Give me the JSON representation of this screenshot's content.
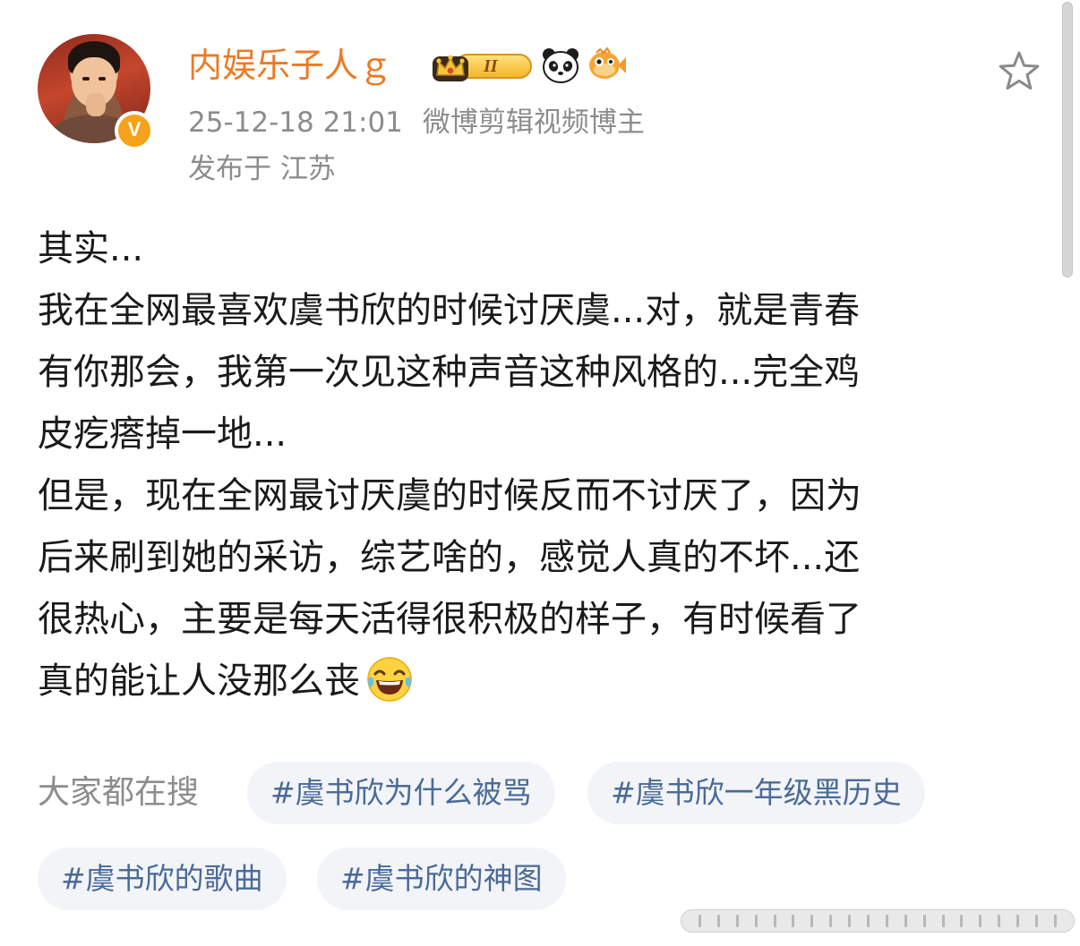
{
  "header": {
    "username": "内娱乐子人ｇ",
    "timestamp": "25-12-18 21:01",
    "source": "微博剪辑视频博主",
    "location": "发布于 江苏",
    "level_badge": "II",
    "verified_mark": "V",
    "badges": [
      "crown-level-badge",
      "panda-icon",
      "fish-icon"
    ]
  },
  "post": {
    "lines": [
      "其实...",
      "我在全网最喜欢虞书欣的时候讨厌虞...对，就是青春",
      "有你那会，我第一次见这种声音这种风格的...完全鸡",
      "皮疙瘩掉一地...",
      "但是，现在全网最讨厌虞的时候反而不讨厌了，因为",
      "后来刷到她的采访，综艺啥的，感觉人真的不坏...还",
      "很热心，主要是每天活得很积极的样子，有时候看了",
      "真的能让人没那么丧"
    ],
    "trailing_emoji": "laughing-tears-emoji"
  },
  "hot_search": {
    "label": "大家都在搜",
    "tags": [
      "#虞书欣为什么被骂",
      "#虞书欣一年级黑历史",
      "#虞书欣的歌曲",
      "#虞书欣的神图"
    ]
  },
  "colors": {
    "username": "#ec7a24",
    "meta": "#8c8c8c",
    "body_text": "#1a1a1a",
    "tag_text": "#4a6a98",
    "tag_bg": "#f2f4f7",
    "verified_badge": "#f7a21b"
  }
}
